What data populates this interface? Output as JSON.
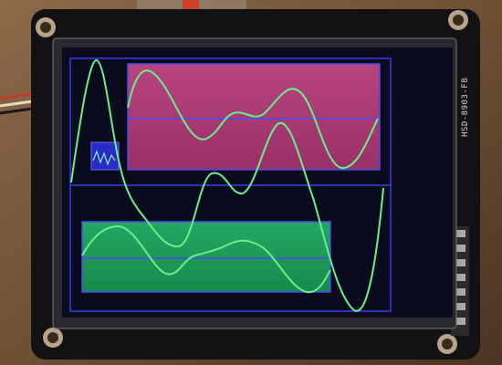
{
  "board": {
    "silkscreen_label": "HSD-8903-F8"
  },
  "display": {
    "background_color": "#0b0b1e",
    "frame_color": "#3a3ae6",
    "trace_color": "#6af08a",
    "panels": [
      {
        "name": "top-panel",
        "color": "#b03a78"
      },
      {
        "name": "bottom-panel",
        "color": "#1f9a5a"
      }
    ]
  },
  "icons": [
    "mini-waveform-icon"
  ]
}
